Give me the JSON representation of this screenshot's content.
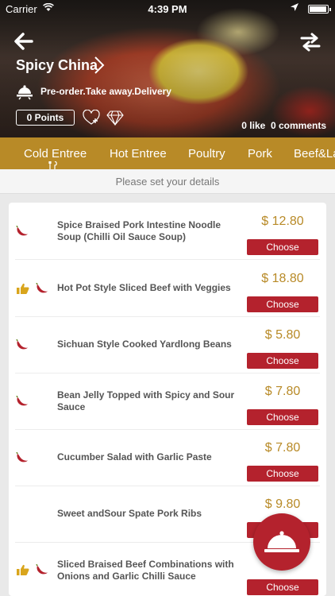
{
  "status_bar": {
    "carrier": "Carrier",
    "time": "4:39 PM"
  },
  "restaurant": {
    "name": "Spicy China",
    "services": "Pre-order.Take away.Delivery",
    "points_label": "0 Points",
    "likes_label": "0 like",
    "comments_label": "0 comments"
  },
  "tabs": [
    "Cold Entree",
    "Hot Entree",
    "Poultry",
    "Pork",
    "Beef&La"
  ],
  "details_prompt": "Please set your details",
  "menu_items": [
    {
      "name": "Spice Braised Pork Intestine Noodle Soup (Chilli Oil Sauce Soup)",
      "price": "$ 12.80",
      "choose": "Choose",
      "thumbs_up": false,
      "spicy": true
    },
    {
      "name": "Hot Pot Style Sliced Beef with Veggies",
      "price": "$ 18.80",
      "choose": "Choose",
      "thumbs_up": true,
      "spicy": true
    },
    {
      "name": "Sichuan Style Cooked Yardlong Beans",
      "price": "$ 5.80",
      "choose": "Choose",
      "thumbs_up": false,
      "spicy": true
    },
    {
      "name": "Bean Jelly Topped with Spicy and Sour Sauce",
      "price": "$ 7.80",
      "choose": "Choose",
      "thumbs_up": false,
      "spicy": true
    },
    {
      "name": "Cucumber Salad with Garlic Paste",
      "price": "$ 7.80",
      "choose": "Choose",
      "thumbs_up": false,
      "spicy": true
    },
    {
      "name": "Sweet andSour Spate Pork Ribs",
      "price": "$ 9.80",
      "choose": "Choose",
      "thumbs_up": false,
      "spicy": false
    },
    {
      "name": "Sliced Braised Beef Combinations with Onions and Garlic Chilli Sauce",
      "price": "",
      "choose": "Choose",
      "thumbs_up": true,
      "spicy": true
    }
  ],
  "icons": {
    "back": "back-arrow-icon",
    "swap": "swap-arrows-icon",
    "service": "food-service-icon",
    "like": "heart-plus-icon",
    "gem": "diamond-icon",
    "thumb": "thumbs-up-icon",
    "spicy": "chili-pepper-icon",
    "cart": "cloche-icon"
  },
  "colors": {
    "accent_gold": "#b88a27",
    "button_red": "#b4222d"
  }
}
